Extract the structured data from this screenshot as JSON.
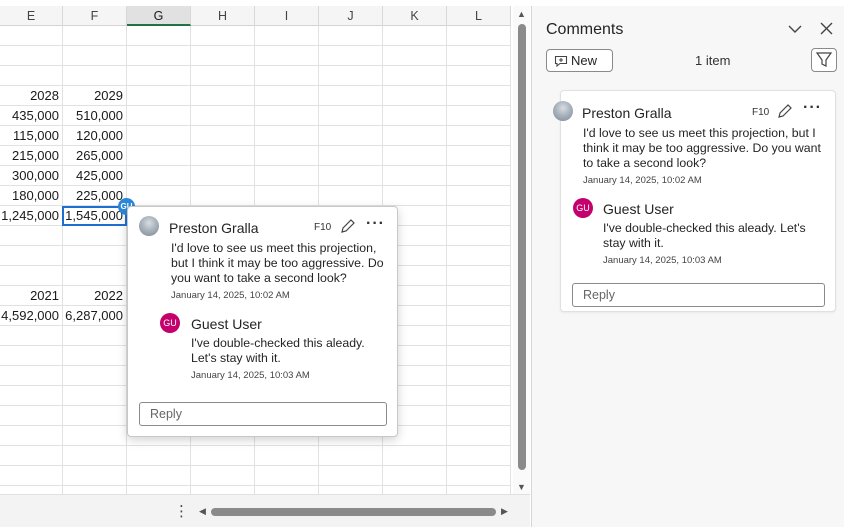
{
  "sheet": {
    "columns": [
      "E",
      "F",
      "G",
      "H",
      "I",
      "J",
      "K",
      "L"
    ],
    "selected_column": "G",
    "cells": [
      {
        "e": "2028",
        "f": "2029"
      },
      {
        "e": "435,000",
        "f": "510,000"
      },
      {
        "e": "115,000",
        "f": "120,000"
      },
      {
        "e": "215,000",
        "f": "265,000"
      },
      {
        "e": "300,000",
        "f": "425,000"
      },
      {
        "e": "180,000",
        "f": "225,000"
      },
      {
        "e": "1,245,000",
        "f": "1,545,000"
      },
      {
        "e": "2021",
        "f": "2022"
      },
      {
        "e": "4,592,000",
        "f": "6,287,000"
      }
    ],
    "comment_indicator_initials": "GU",
    "more_options_glyph": "⋮"
  },
  "popup": {
    "thread": {
      "author": "Preston Gralla",
      "cell_ref": "F10",
      "text": "I'd love to see us meet this projection, but I think it may be too aggressive. Do you want to take a second look?",
      "timestamp": "January 14, 2025, 10:02 AM"
    },
    "reply": {
      "initials": "GU",
      "author": "Guest User",
      "text": "I've double-checked this aleady. Let's stay with it.",
      "timestamp": "January 14, 2025, 10:03 AM"
    },
    "reply_placeholder": "Reply"
  },
  "pane": {
    "title": "Comments",
    "new_label": "New",
    "item_count": "1 item",
    "thread": {
      "author": "Preston Gralla",
      "cell_ref": "F10",
      "text": "I'd love to see us meet this projection, but I think it may be too aggressive. Do you want to take a second look?",
      "timestamp": "January 14, 2025, 10:02 AM"
    },
    "reply": {
      "initials": "GU",
      "author": "Guest User",
      "text": "I've double-checked this aleady. Let's stay with it.",
      "timestamp": "January 14, 2025, 10:03 AM"
    },
    "reply_placeholder": "Reply"
  },
  "colors": {
    "accent_blue": "#1e6fd0",
    "guest_avatar": "#c3006b",
    "excel_green": "#217346"
  },
  "icons": [
    "new-comment-icon",
    "filter-icon",
    "chevron-down-icon",
    "close-icon",
    "edit-icon",
    "more-icon"
  ]
}
